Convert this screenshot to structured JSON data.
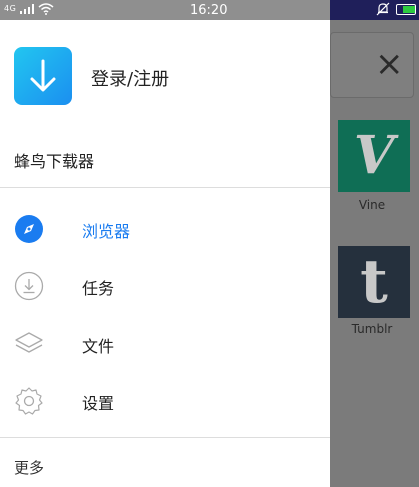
{
  "status_bar": {
    "network": "4G",
    "time": "16:20"
  },
  "drawer": {
    "login_label": "登录/注册",
    "app_name": "蜂鸟下载器",
    "menu": [
      {
        "label": "浏览器",
        "icon": "compass-icon",
        "active": true
      },
      {
        "label": "任务",
        "icon": "download-icon",
        "active": false
      },
      {
        "label": "文件",
        "icon": "layers-icon",
        "active": false
      },
      {
        "label": "设置",
        "icon": "gear-icon",
        "active": false
      }
    ],
    "more_label": "更多"
  },
  "background": {
    "tiles": [
      {
        "label": "Vine",
        "glyph": "V"
      },
      {
        "label": "Tumblr",
        "glyph": "t"
      }
    ]
  },
  "colors": {
    "accent": "#1a7cf0",
    "logo_gradient_start": "#22c6f0",
    "logo_gradient_end": "#1b8ff0"
  }
}
